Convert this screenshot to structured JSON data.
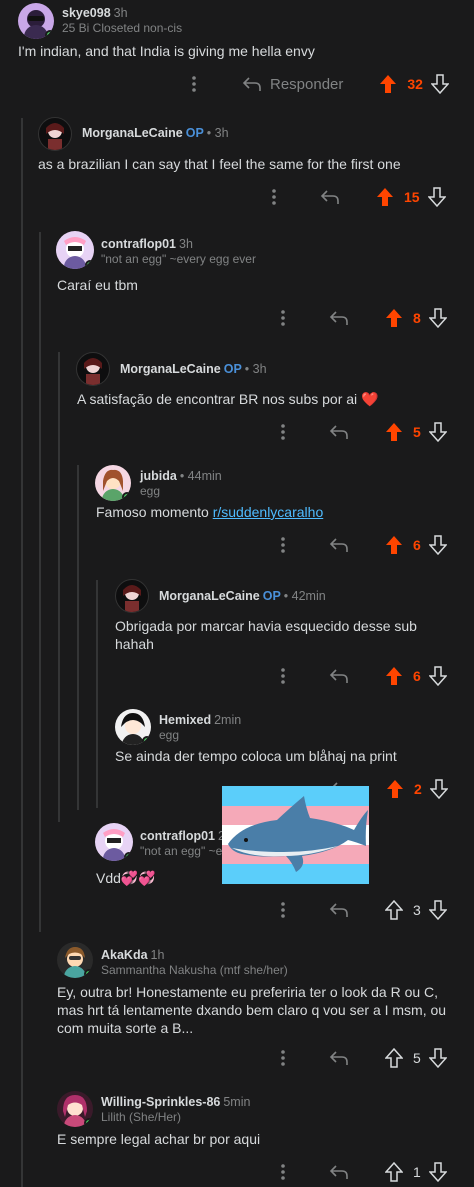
{
  "comments": [
    {
      "user": "skye098",
      "op": "",
      "time": "3h",
      "flair": "25 Bi Closeted non-cis",
      "text": "I'm indian, and that India is giving me hella envy",
      "score": "32",
      "reply_label": "Responder"
    },
    {
      "user": "MorganaLeCaine",
      "op": "OP",
      "time": "• 3h",
      "flair": "",
      "text": "as a brazilian I can say that I feel the same for the first one",
      "score": "15"
    },
    {
      "user": "contraflop01",
      "op": "",
      "time": "3h",
      "flair": "\"not an egg\" ~every egg ever",
      "text": "Caraí eu tbm",
      "score": "8"
    },
    {
      "user": "MorganaLeCaine",
      "op": "OP",
      "time": "• 3h",
      "flair": "",
      "text": "A satisfação de encontrar BR nos subs por ai ❤️",
      "score": "5"
    },
    {
      "user": "jubida",
      "op": "",
      "time": "• 44min",
      "flair": "egg",
      "text_prefix": "Famoso momento ",
      "link": "r/suddenlycaralho",
      "score": "6"
    },
    {
      "user": "MorganaLeCaine",
      "op": "OP",
      "time": "• 42min",
      "flair": "",
      "text": "Obrigada por marcar havia esquecido desse sub hahah",
      "score": "6"
    },
    {
      "user": "Hemixed",
      "op": "",
      "time": "2min",
      "flair": "egg",
      "text": "Se ainda der tempo coloca um blåhaj na print",
      "score": "2"
    },
    {
      "user": "contraflop01",
      "op": "",
      "time": "2",
      "flair": "\"not an egg\" ~e",
      "text": "Vdd💞💞",
      "score": "3"
    },
    {
      "user": "AkaKda",
      "op": "",
      "time": "1h",
      "flair": "Sammantha Nakusha (mtf she/her)",
      "text": "Ey, outra br! Honestamente eu preferiria ter o look da R ou C, mas hrt tá lentamente dxando bem claro q vou ser a I msm, ou com muita sorte a B...",
      "score": "5"
    },
    {
      "user": "Willing-Sprinkles-86",
      "op": "",
      "time": "5min",
      "flair": "Lilith (She/Her)",
      "text": "E sempre legal achar br por aqui",
      "score": "1"
    }
  ],
  "colors": {
    "upvote": "#ff4500",
    "op": "#4a90d9",
    "link": "#4fbcff",
    "online": "#46d160",
    "background": "#1a1a1b"
  },
  "icons": [
    "more-icon",
    "reply-icon",
    "upvote-icon",
    "downvote-icon",
    "shark-sticker"
  ]
}
